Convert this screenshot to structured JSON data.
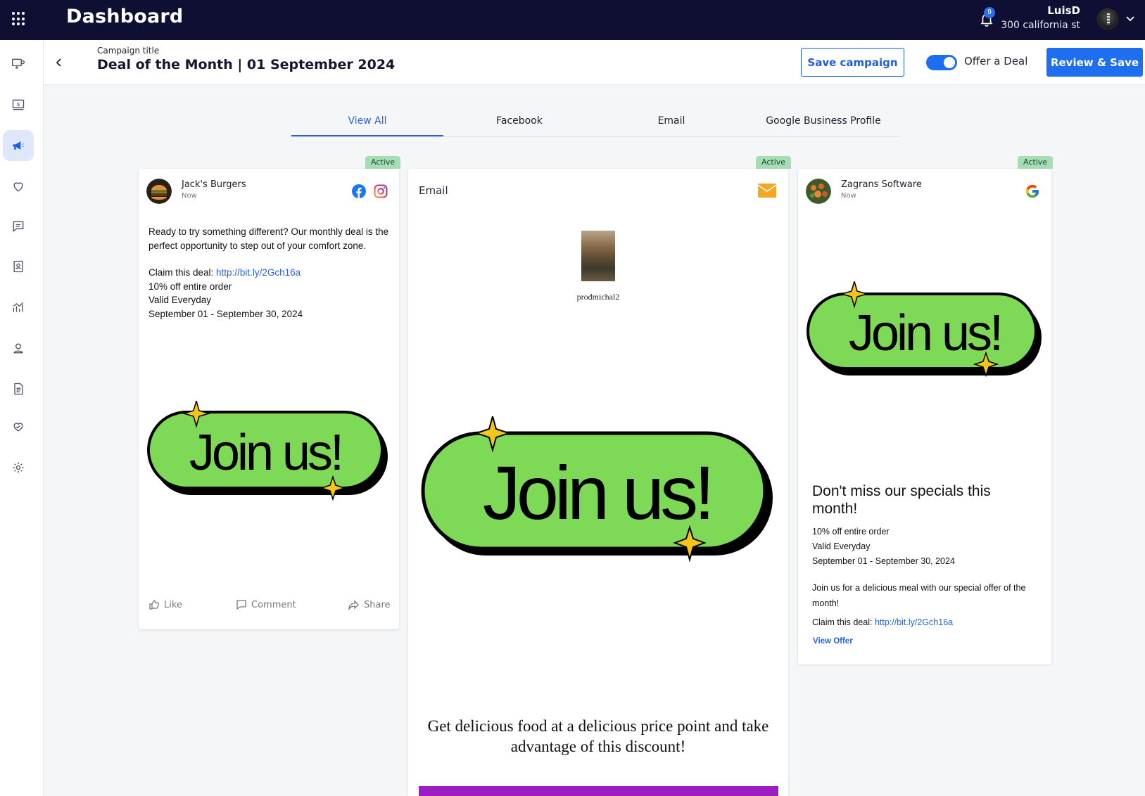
{
  "topbar": {
    "title": "Dashboard",
    "notification_count": "9",
    "user_name": "LuisD",
    "user_location": "300 california st"
  },
  "header": {
    "campaign_label": "Campaign title",
    "campaign_title": "Deal of the Month | 01 September 2024",
    "save_campaign": "Save campaign",
    "offer_toggle_label": "Offer a Deal",
    "offer_toggle_on": true,
    "review_save": "Review & Save"
  },
  "tabs": [
    {
      "label": "View All",
      "active": true
    },
    {
      "label": "Facebook",
      "active": false
    },
    {
      "label": "Email",
      "active": false
    },
    {
      "label": "Google Business Profile",
      "active": false
    }
  ],
  "badge_label": "Active",
  "facebook_card": {
    "business_name": "Jack's Burgers",
    "time": "Now",
    "intro": "Ready to try something different? Our monthly deal is the perfect opportunity to step out of your comfort zone.",
    "claim_prefix": "Claim this deal: ",
    "claim_link": "http://bit.ly/2Gch16a",
    "offer": "10% off entire order",
    "validity": "Valid Everyday",
    "dates": "September 01 - September 30, 2024",
    "image_text": "Join us!",
    "like": "Like",
    "comment": "Comment",
    "share": "Share"
  },
  "email_card": {
    "header": "Email",
    "photo_caption": "prodmichal2",
    "image_text": "Join us!",
    "tagline": "Get delicious food at a delicious price point and take advantage of this discount!"
  },
  "google_card": {
    "business_name": "Zagrans Software",
    "time": "Now",
    "image_text": "Join us!",
    "title": "Don't miss our specials this month!",
    "offer": "10% off entire order",
    "validity": "Valid Everyday",
    "dates": "September 01 - September 30, 2024",
    "description": "Join us for a delicious meal with our special offer of the month!",
    "claim_prefix": "Claim this deal: ",
    "claim_link": "http://bit.ly/2Gch16a",
    "view_offer": "View Offer"
  },
  "colors": {
    "topbar_bg": "#0f0f33",
    "primary": "#1e6ff0",
    "active_badge": "#a6ddb3",
    "join_green": "#7ed957",
    "email_purple": "#9b1cc0"
  },
  "sidebar_icons": [
    "monitor-settings-icon",
    "billing-icon",
    "megaphone-icon",
    "heart-icon",
    "chat-icon",
    "contacts-icon",
    "analytics-icon",
    "user-support-icon",
    "document-icon",
    "handshake-heart-icon",
    "settings-icon"
  ]
}
